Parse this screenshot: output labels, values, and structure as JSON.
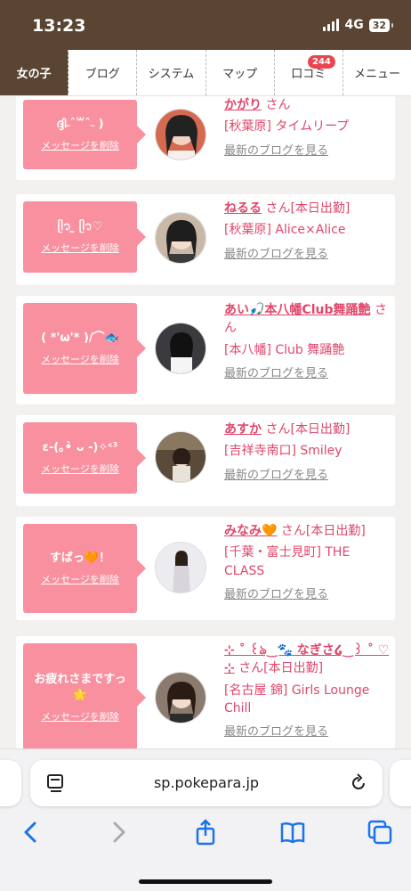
{
  "status": {
    "time": "13:23",
    "network": "4G",
    "battery": "32"
  },
  "nav": {
    "items": [
      {
        "label": "女の子",
        "active": true
      },
      {
        "label": "ブログ"
      },
      {
        "label": "システム"
      },
      {
        "label": "マップ"
      },
      {
        "label": "口コミ",
        "badge": "244"
      },
      {
        "label": "メニュー"
      }
    ]
  },
  "cards": [
    {
      "bubble": "ദ്ദി˶ˆ꒳ˆ˵ )",
      "delete": "メッセージを削除",
      "name": "かがり",
      "san": "さん",
      "shop": "[秋葉原] タイムリープ",
      "blog": "最新のブログを見る"
    },
    {
      "bubble": "ᥫ᭡ ̫ ᥫ᭡♡",
      "delete": "メッセージを削除",
      "name": "ねるる",
      "san": "さん[本日出勤]",
      "shop": "[秋葉原] Alice×Alice",
      "blog": "最新のブログを見る"
    },
    {
      "bubble": "( *'ω'* )/⌒🐟",
      "delete": "メッセージを削除",
      "name": "あい🎣本八幡Club舞踊艶",
      "san": "さん",
      "shop": "[本八幡] Club 舞踊艶",
      "blog": "最新のブログを見る"
    },
    {
      "bubble": "ε-(｡•̀ ᴗ -)✧ᶜ³",
      "delete": "メッセージを削除",
      "name": "あすか",
      "san": "さん[本日出勤]",
      "shop": "[吉祥寺南口] Smiley",
      "blog": "最新のブログを見る"
    },
    {
      "bubble": "すばっ🧡！",
      "delete": "メッセージを削除",
      "name": "みなみ🧡",
      "san": "さん[本日出勤]",
      "shop": "[千葉・富士見町] THE CLASS",
      "blog": "最新のブログを見る"
    },
    {
      "bubble": "お疲れさまですっ🌟",
      "delete": "メッセージを削除",
      "name": "⊹ ˚ ꒰ঌ‿🐾 なぎさ໒‿꒱ ˚ ♡ ⊹",
      "san": "さん[本日出勤]",
      "shop": "[名古屋 錦] Girls Lounge Chill",
      "blog": "最新のブログを見る"
    }
  ],
  "browser": {
    "url": "sp.pokepara.jp"
  }
}
